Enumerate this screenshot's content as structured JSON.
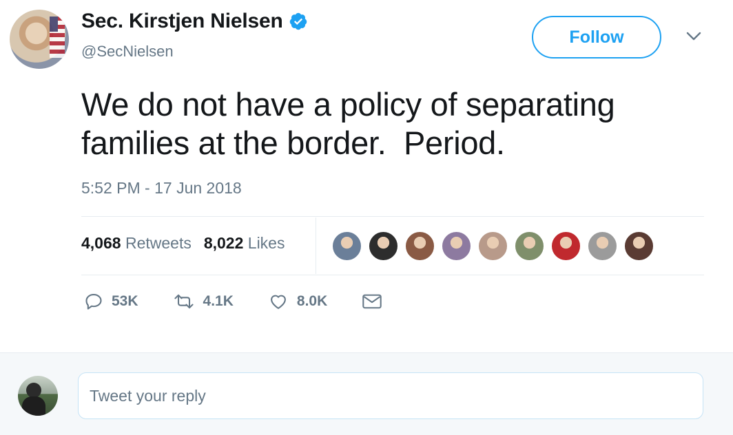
{
  "author": {
    "display_name": "Sec. Kirstjen Nielsen",
    "handle": "@SecNielsen",
    "verified": true,
    "avatar_icon": "profile-photo"
  },
  "follow_button": {
    "label": "Follow"
  },
  "menu_icon": "chevron-down-icon",
  "tweet": {
    "text": "We do not have a policy of separating\nfamilies at the border.  Period.",
    "timestamp": "5:52 PM - 17 Jun 2018"
  },
  "stats": {
    "retweets_count": "4,068",
    "retweets_label": "Retweets",
    "likes_count": "8,022",
    "likes_label": "Likes"
  },
  "likers": [
    {
      "name": "liker-1",
      "color": "#6b7f99"
    },
    {
      "name": "liker-2",
      "color": "#2d2d2d"
    },
    {
      "name": "liker-3",
      "color": "#8a5a44"
    },
    {
      "name": "liker-4",
      "color": "#8d7aa0"
    },
    {
      "name": "liker-5",
      "color": "#b89a8a"
    },
    {
      "name": "liker-6",
      "color": "#7f8f6b"
    },
    {
      "name": "liker-7",
      "color": "#c0292e"
    },
    {
      "name": "liker-8",
      "color": "#9b9b9b"
    },
    {
      "name": "liker-9",
      "color": "#5a3b33"
    }
  ],
  "actions": {
    "reply_count": "53K",
    "retweet_count": "4.1K",
    "like_count": "8.0K"
  },
  "reply_box": {
    "placeholder": "Tweet your reply"
  },
  "colors": {
    "accent": "#1da1f2",
    "muted": "#657786",
    "text": "#14171a",
    "divider": "#e6ecf0"
  }
}
